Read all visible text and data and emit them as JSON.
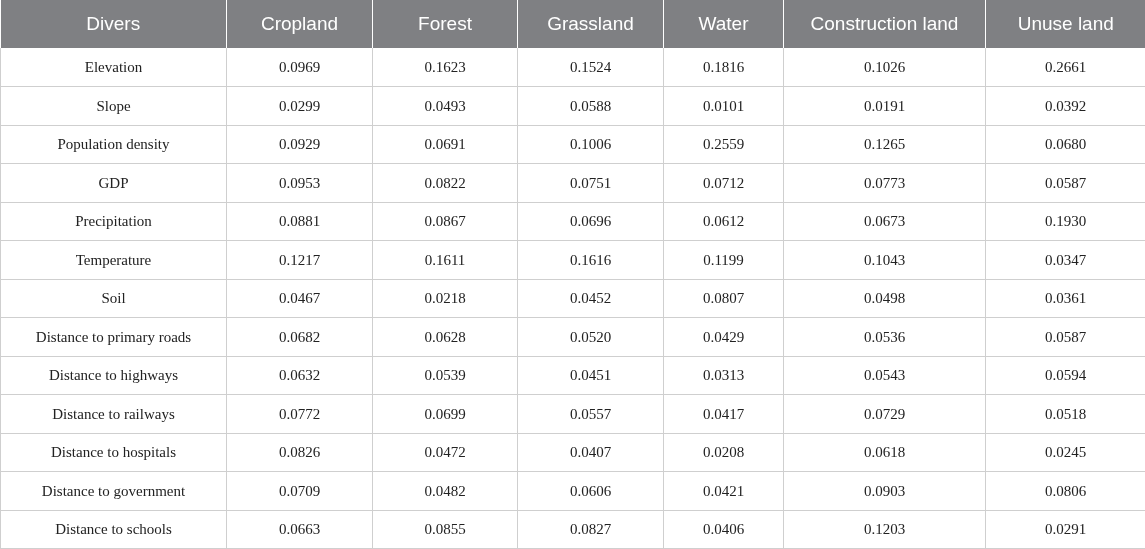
{
  "table": {
    "columns": [
      "Divers",
      "Cropland",
      "Forest",
      "Grassland",
      "Water",
      "Construction land",
      "Unuse land"
    ],
    "rows": [
      [
        "Elevation",
        "0.0969",
        "0.1623",
        "0.1524",
        "0.1816",
        "0.1026",
        "0.2661"
      ],
      [
        "Slope",
        "0.0299",
        "0.0493",
        "0.0588",
        "0.0101",
        "0.0191",
        "0.0392"
      ],
      [
        "Population density",
        "0.0929",
        "0.0691",
        "0.1006",
        "0.2559",
        "0.1265",
        "0.0680"
      ],
      [
        "GDP",
        "0.0953",
        "0.0822",
        "0.0751",
        "0.0712",
        "0.0773",
        "0.0587"
      ],
      [
        "Precipitation",
        "0.0881",
        "0.0867",
        "0.0696",
        "0.0612",
        "0.0673",
        "0.1930"
      ],
      [
        "Temperature",
        "0.1217",
        "0.1611",
        "0.1616",
        "0.1199",
        "0.1043",
        "0.0347"
      ],
      [
        "Soil",
        "0.0467",
        "0.0218",
        "0.0452",
        "0.0807",
        "0.0498",
        "0.0361"
      ],
      [
        "Distance to primary roads",
        "0.0682",
        "0.0628",
        "0.0520",
        "0.0429",
        "0.0536",
        "0.0587"
      ],
      [
        "Distance to highways",
        "0.0632",
        "0.0539",
        "0.0451",
        "0.0313",
        "0.0543",
        "0.0594"
      ],
      [
        "Distance to railways",
        "0.0772",
        "0.0699",
        "0.0557",
        "0.0417",
        "0.0729",
        "0.0518"
      ],
      [
        "Distance to hospitals",
        "0.0826",
        "0.0472",
        "0.0407",
        "0.0208",
        "0.0618",
        "0.0245"
      ],
      [
        "Distance to government",
        "0.0709",
        "0.0482",
        "0.0606",
        "0.0421",
        "0.0903",
        "0.0806"
      ],
      [
        "Distance to schools",
        "0.0663",
        "0.0855",
        "0.0827",
        "0.0406",
        "0.1203",
        "0.0291"
      ]
    ]
  }
}
